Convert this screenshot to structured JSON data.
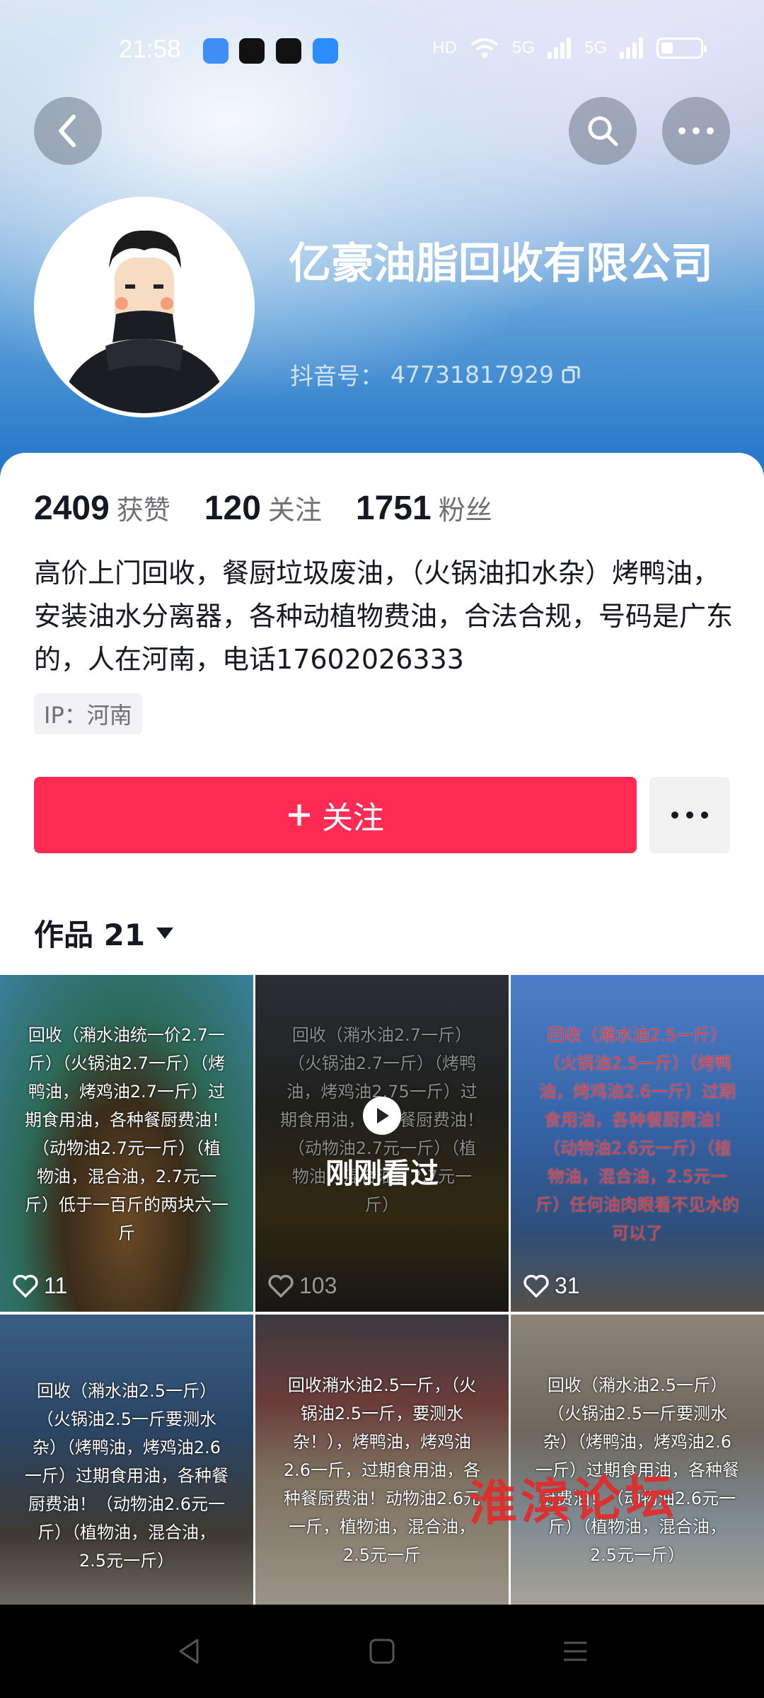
{
  "status_bar": {
    "time": "21:58",
    "network_labels": [
      "HD",
      "5G",
      "5G"
    ]
  },
  "profile": {
    "name": "亿豪油脂回收有限公司",
    "douyin_id_label": "抖音号：",
    "douyin_id": "47731817929",
    "stats": [
      {
        "value": "2409",
        "label": "获赞"
      },
      {
        "value": "120",
        "label": "关注"
      },
      {
        "value": "1751",
        "label": "粉丝"
      }
    ],
    "bio": "高价上门回收，餐厨垃圾废油，（火锅油扣水杂）烤鸭油，安装油水分离器，各种动植物费油，合法合规，号码是广东的，人在河南，电话17602026333",
    "ip": "IP：河南"
  },
  "actions": {
    "follow_label": "关注"
  },
  "works": {
    "label": "作品 21",
    "recent_label": "刚刚看过",
    "items": [
      {
        "text": "回收（潲水油统一价2.7一斤）（火锅油2.7一斤）（烤鸭油，烤鸡油2.7一斤）过期食用油，各种餐厨费油！（动物油2.7元一斤）（植物油，混合油，2.7元一斤）低于一百斤的两块六一斤",
        "likes": "11"
      },
      {
        "text": "回收（潲水油2.7一斤）（火锅油2.7一斤）（烤鸭油，烤鸡油2.75一斤）过期食用油，各种餐厨费油！（动物油2.7元一斤）（植物油，混合油，2.7元一斤）",
        "likes": "103"
      },
      {
        "text": "回收（潲水油2.5一斤）（火锅油2.5一斤）（烤鸭油，烤鸡油2.6一斤）过期食用油，各种餐厨费油！（动物油2.6元一斤）（植物油，混合油，2.5元一斤）任何油肉眼看不见水的可以了",
        "likes": "31"
      },
      {
        "text": "回收（潲水油2.5一斤）（火锅油2.5一斤要测水杂）（烤鸭油，烤鸡油2.6一斤）过期食用油，各种餐厨费油！（动物油2.6元一斤）（植物油，混合油，2.5元一斤）",
        "likes": ""
      },
      {
        "text": "回收潲水油2.5一斤，（火锅油2.5一斤，要测水杂！），烤鸭油，烤鸡油2.6一斤，过期食用油，各种餐厨费油！动物油2.6元一斤，植物油，混合油，2.5元一斤",
        "likes": ""
      },
      {
        "text": "回收（潲水油2.5一斤）（火锅油2.5一斤要测水杂）（烤鸭油，烤鸡油2.6一斤）过期食用油，各种餐厨费油！（动物油2.6元一斤）（植物油，混合油，2.5元一斤）",
        "likes": ""
      }
    ]
  },
  "watermark": "淮滨论坛",
  "colors": {
    "accent": "#fe2c55",
    "header_blue": "#1f73c7"
  }
}
